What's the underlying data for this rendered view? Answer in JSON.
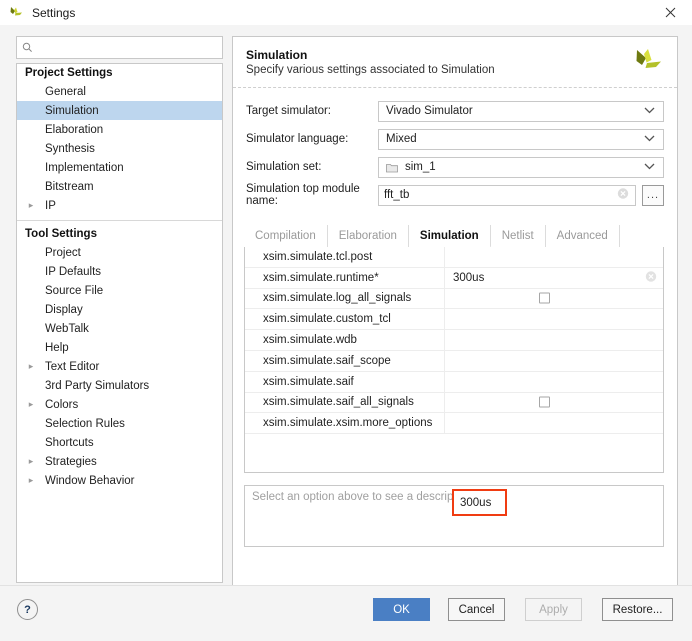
{
  "window": {
    "title": "Settings",
    "logo_icon": "vivado-logo-icon",
    "close_icon": "close-icon"
  },
  "search": {
    "value": "",
    "placeholder": "",
    "icon": "search-icon"
  },
  "sidebar": {
    "groups": [
      {
        "label": "Project Settings",
        "items": [
          {
            "label": "General",
            "expandable": false,
            "selected": false
          },
          {
            "label": "Simulation",
            "expandable": false,
            "selected": true
          },
          {
            "label": "Elaboration",
            "expandable": false,
            "selected": false
          },
          {
            "label": "Synthesis",
            "expandable": false,
            "selected": false
          },
          {
            "label": "Implementation",
            "expandable": false,
            "selected": false
          },
          {
            "label": "Bitstream",
            "expandable": false,
            "selected": false
          },
          {
            "label": "IP",
            "expandable": true,
            "selected": false
          }
        ]
      },
      {
        "label": "Tool Settings",
        "items": [
          {
            "label": "Project",
            "expandable": false,
            "selected": false
          },
          {
            "label": "IP Defaults",
            "expandable": false,
            "selected": false
          },
          {
            "label": "Source File",
            "expandable": false,
            "selected": false
          },
          {
            "label": "Display",
            "expandable": false,
            "selected": false
          },
          {
            "label": "WebTalk",
            "expandable": false,
            "selected": false
          },
          {
            "label": "Help",
            "expandable": false,
            "selected": false
          },
          {
            "label": "Text Editor",
            "expandable": true,
            "selected": false
          },
          {
            "label": "3rd Party Simulators",
            "expandable": false,
            "selected": false
          },
          {
            "label": "Colors",
            "expandable": true,
            "selected": false
          },
          {
            "label": "Selection Rules",
            "expandable": false,
            "selected": false
          },
          {
            "label": "Shortcuts",
            "expandable": false,
            "selected": false
          },
          {
            "label": "Strategies",
            "expandable": true,
            "selected": false
          },
          {
            "label": "Window Behavior",
            "expandable": true,
            "selected": false
          }
        ]
      }
    ]
  },
  "panel": {
    "title": "Simulation",
    "subtitle": "Specify various settings associated to Simulation",
    "logo_icon": "vivado-pinwheel-icon",
    "fields": [
      {
        "label": "Target simulator:",
        "value": "Vivado Simulator",
        "type": "combo"
      },
      {
        "label": "Simulator language:",
        "value": "Mixed",
        "type": "combo"
      },
      {
        "label": "Simulation set:",
        "value": "sim_1",
        "type": "combo",
        "icon": "folder-icon"
      },
      {
        "label": "Simulation top module name:",
        "value": "fft_tb",
        "type": "text",
        "clear_icon": "clear-circle-icon",
        "browse_label": "..."
      }
    ]
  },
  "tabs": [
    {
      "label": "Compilation",
      "active": false
    },
    {
      "label": "Elaboration",
      "active": false
    },
    {
      "label": "Simulation",
      "active": true
    },
    {
      "label": "Netlist",
      "active": false
    },
    {
      "label": "Advanced",
      "active": false
    }
  ],
  "properties": [
    {
      "name": "xsim.simulate.tcl.post",
      "value": "",
      "control": "text"
    },
    {
      "name": "xsim.simulate.runtime*",
      "value": "300us",
      "control": "text",
      "highlighted": true,
      "clear_icon": "clear-circle-icon"
    },
    {
      "name": "xsim.simulate.log_all_signals",
      "value": "",
      "control": "checkbox",
      "checked": false
    },
    {
      "name": "xsim.simulate.custom_tcl",
      "value": "",
      "control": "text"
    },
    {
      "name": "xsim.simulate.wdb",
      "value": "",
      "control": "text"
    },
    {
      "name": "xsim.simulate.saif_scope",
      "value": "",
      "control": "text"
    },
    {
      "name": "xsim.simulate.saif",
      "value": "",
      "control": "text"
    },
    {
      "name": "xsim.simulate.saif_all_signals",
      "value": "",
      "control": "checkbox",
      "checked": false
    },
    {
      "name": "xsim.simulate.xsim.more_options",
      "value": "",
      "control": "text"
    }
  ],
  "highlight": {
    "value": "300us",
    "color": "#f03c12"
  },
  "description": {
    "text": "Select an option above to see a description of it"
  },
  "footer": {
    "help_label": "?",
    "ok_label": "OK",
    "cancel_label": "Cancel",
    "apply_label": "Apply",
    "restore_label": "Restore...",
    "ok_color": "#4a7fc4"
  }
}
